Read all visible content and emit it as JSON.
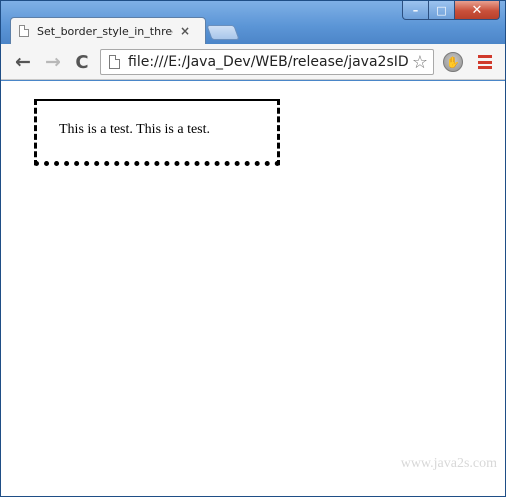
{
  "window": {
    "controls": {
      "minimize": "–",
      "maximize": "□",
      "close": "✕"
    }
  },
  "tab": {
    "title": "Set_border_style_in_three_",
    "close": "×",
    "icon": "page-icon"
  },
  "toolbar": {
    "back": "←",
    "forward": "→",
    "reload": "C",
    "url": "file:///E:/Java_Dev/WEB/release/java2sID",
    "star": "☆",
    "extension": "✋",
    "menu": "menu-icon"
  },
  "page": {
    "demo_text": "This is a test. This is a test.",
    "watermark": "www.java2s.com"
  },
  "colors": {
    "window_frame": "#4a86c8",
    "menu_icon": "#d0392b",
    "close_button": "#c9503a"
  }
}
